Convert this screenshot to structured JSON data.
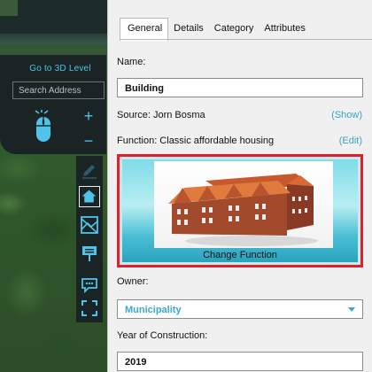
{
  "navigation": {
    "goto_3d_label": "Go to 3D Level",
    "search_placeholder": "Search Address",
    "zoom_in": "+",
    "zoom_out": "−"
  },
  "toolbar": {
    "items": [
      "pencil-icon",
      "house-icon",
      "terrain-icon",
      "sign-icon",
      "chat-icon",
      "fullscreen-icon"
    ],
    "active": "house-icon"
  },
  "panel": {
    "tabs": [
      {
        "label": "General",
        "active": true
      },
      {
        "label": "Details",
        "active": false
      },
      {
        "label": "Category",
        "active": false
      },
      {
        "label": "Attributes",
        "active": false
      }
    ],
    "name_label": "Name:",
    "name_value": "Building",
    "source_text": "Source: Jorn Bosma",
    "source_link": "(Show)",
    "function_text": "Function: Classic affordable housing",
    "function_link": "(Edit)",
    "change_function_label": "Change Function",
    "owner_label": "Owner:",
    "owner_value": "Municipality",
    "year_label": "Year of Construction:",
    "year_value": "2019"
  },
  "colors": {
    "accent": "#4fc3e8",
    "highlight_border": "#e0202c",
    "link": "#3ba3c9"
  }
}
